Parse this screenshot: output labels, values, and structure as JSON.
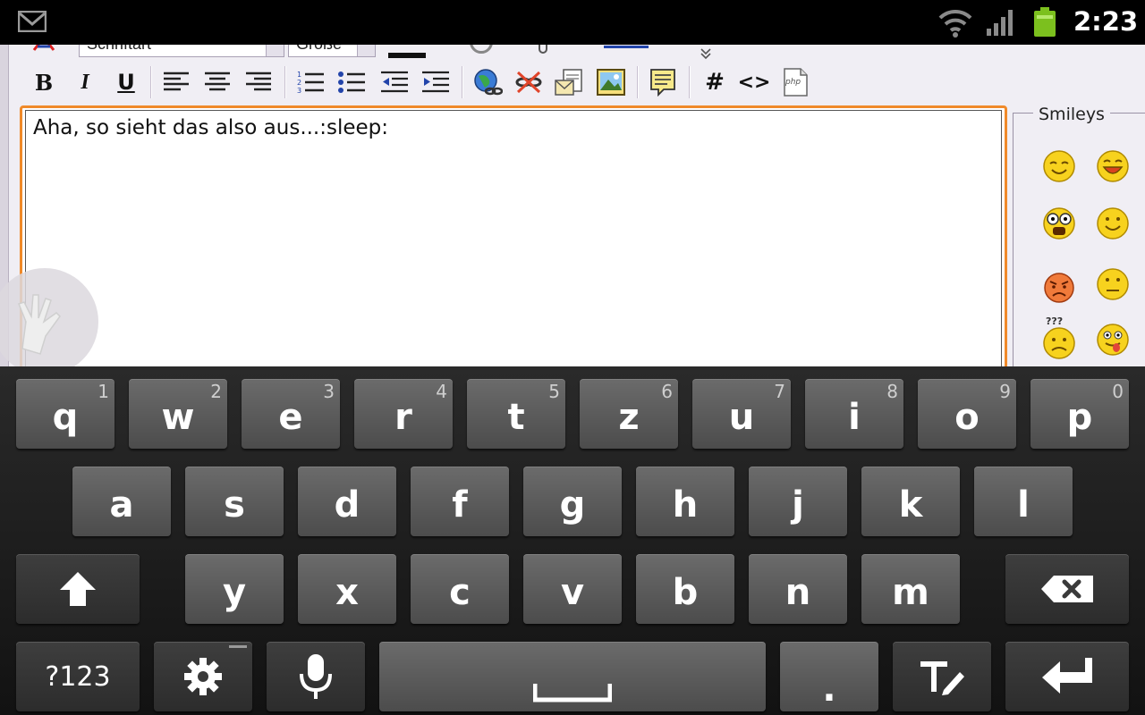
{
  "status_bar": {
    "time": "2:23",
    "icons": [
      "gmail-icon",
      "wifi-icon",
      "signal-icon",
      "battery-icon"
    ],
    "battery_color": "#7cc01e"
  },
  "editor": {
    "toolbar": {
      "font_select": "Schriftart",
      "size_select": "Größe",
      "buttons": [
        "bold",
        "italic",
        "underline",
        "align-left",
        "align-center",
        "align-right",
        "ordered-list",
        "unordered-list",
        "outdent",
        "indent",
        "insert-link",
        "remove-link",
        "insert-email",
        "insert-image",
        "quote",
        "code-hash",
        "html-code",
        "php-code"
      ]
    },
    "toolbar_labels": {
      "bold": "B",
      "italic": "I",
      "underline": "U",
      "hash": "#",
      "code": "<>",
      "php": "php"
    },
    "content": "Aha, so sieht das also aus...:sleep:",
    "border_color": "#f08a2a"
  },
  "smileys": {
    "title": "Smileys",
    "items": [
      "smile-icon",
      "laugh-icon",
      "shocked-icon",
      "happy-icon",
      "angry-icon",
      "worried-icon",
      "confused-icon",
      "tongue-icon"
    ],
    "confused_label": "???"
  },
  "keyboard": {
    "row1": [
      {
        "label": "q",
        "hint": "1"
      },
      {
        "label": "w",
        "hint": "2"
      },
      {
        "label": "e",
        "hint": "3"
      },
      {
        "label": "r",
        "hint": "4"
      },
      {
        "label": "t",
        "hint": "5"
      },
      {
        "label": "z",
        "hint": "6"
      },
      {
        "label": "u",
        "hint": "7"
      },
      {
        "label": "i",
        "hint": "8"
      },
      {
        "label": "o",
        "hint": "9"
      },
      {
        "label": "p",
        "hint": "0"
      }
    ],
    "row2": [
      "a",
      "s",
      "d",
      "f",
      "g",
      "h",
      "j",
      "k",
      "l"
    ],
    "row3": [
      "y",
      "x",
      "c",
      "v",
      "b",
      "n",
      "m"
    ],
    "symbols_label": "?123",
    "period_label": ".",
    "icons": [
      "shift-icon",
      "backspace-icon",
      "settings-icon",
      "microphone-icon",
      "space-icon",
      "text-edit-icon",
      "enter-icon"
    ]
  }
}
